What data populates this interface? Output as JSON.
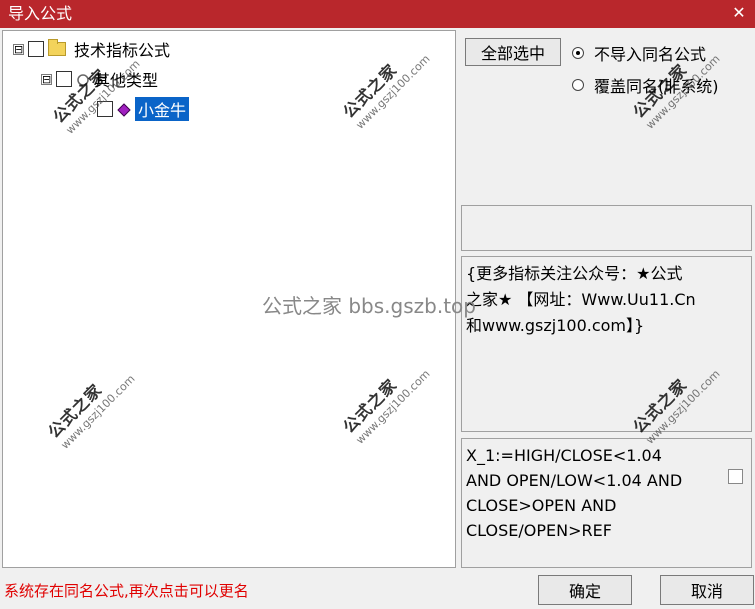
{
  "titlebar": {
    "title": "导入公式",
    "close": "✕"
  },
  "tree": {
    "root": {
      "expander": "⊟",
      "label": "技术指标公式"
    },
    "group": {
      "expander": "⊟",
      "label": "其他类型"
    },
    "item": {
      "label": "小金牛"
    }
  },
  "controls": {
    "select_all": "全部选中",
    "radio_no_import": "不导入同名公式",
    "radio_overwrite": "覆盖同名(非系统)"
  },
  "description": "{更多指标关注公众号：★公式\n之家★ 【网址：Www.Uu11.Cn\n和www.gszj100.com】}",
  "code": "X_1:=HIGH/CLOSE<1.04\nAND OPEN/LOW<1.04 AND\nCLOSE>OPEN AND\nCLOSE/OPEN>REF",
  "status": "系统存在同名公式,再次点击可以更名",
  "buttons": {
    "ok": "确定",
    "cancel": "取消"
  },
  "watermark": {
    "brand": "公式之家",
    "url": "www.gszj100.com",
    "center": "公式之家 bbs.gszb.top"
  },
  "colors": {
    "titlebar": "#b9272c",
    "selection": "#0a64c8",
    "status": "#e00000"
  }
}
